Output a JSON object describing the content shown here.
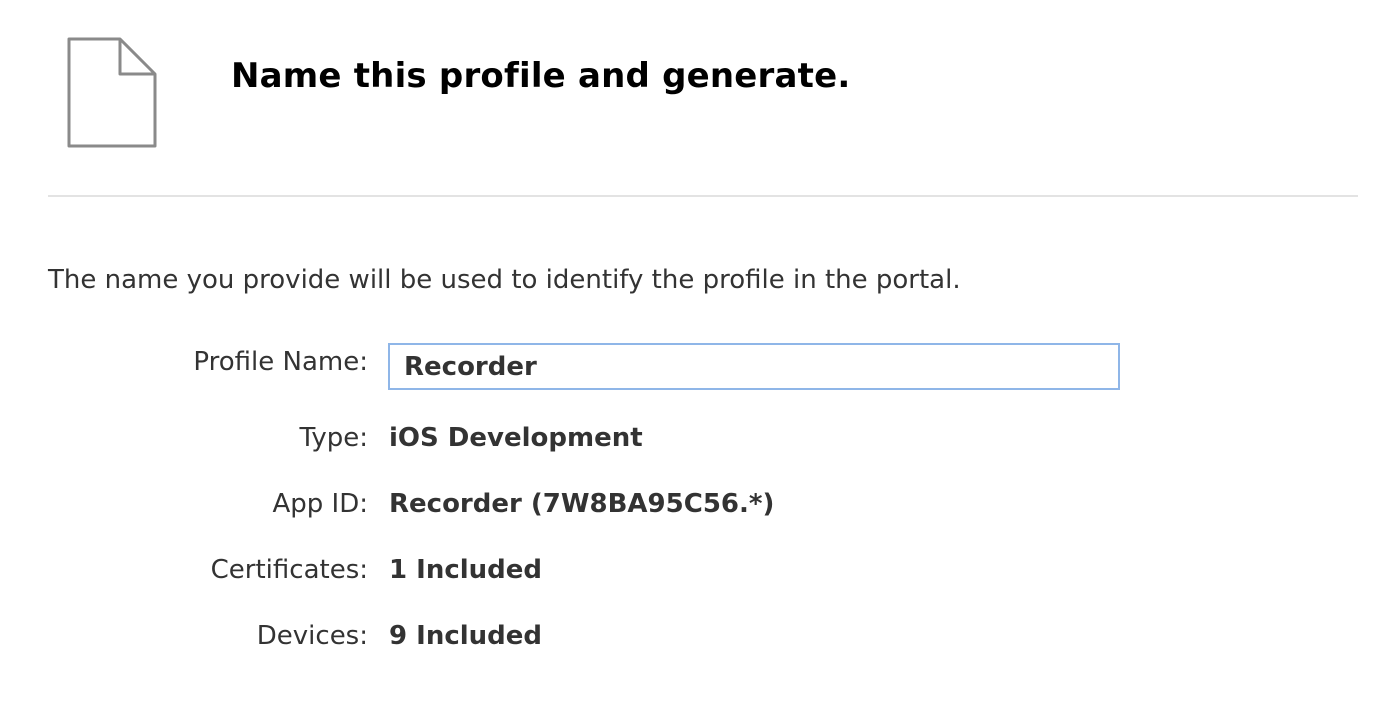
{
  "header": {
    "icon": "document-icon",
    "title": "Name this profile and generate."
  },
  "intro_text": "The name you provide will be used to identify the profile in the portal.",
  "form": {
    "profile_name": {
      "label": "Profile Name:",
      "value": "Recorder"
    },
    "type": {
      "label": "Type:",
      "value": "iOS Development"
    },
    "app_id": {
      "label": "App ID:",
      "value": "Recorder (7W8BA95C56.*)"
    },
    "certificates": {
      "label": "Certificates:",
      "value": "1 Included"
    },
    "devices": {
      "label": "Devices:",
      "value": "9 Included"
    }
  },
  "colors": {
    "input_border_focus": "#8fb6e8",
    "divider": "#e3e3e3",
    "icon_stroke": "#8a8a8a"
  }
}
